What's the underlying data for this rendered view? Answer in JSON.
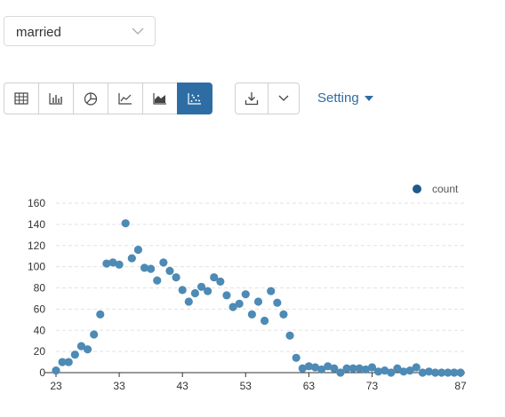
{
  "filter": {
    "selected": "married"
  },
  "toolbar": {
    "views": [
      {
        "icon": "table-icon"
      },
      {
        "icon": "bar-chart-icon"
      },
      {
        "icon": "pie-chart-icon"
      },
      {
        "icon": "line-chart-icon"
      },
      {
        "icon": "area-chart-icon"
      },
      {
        "icon": "scatter-chart-icon",
        "active": true
      }
    ],
    "setting_label": "Setting"
  },
  "colors": {
    "accent": "#2e6da4",
    "point": "#4d8ab5"
  },
  "chart_data": {
    "type": "scatter",
    "legend": "count",
    "legend_position": "top-right",
    "xlim": [
      23,
      87
    ],
    "ylim": [
      0,
      160
    ],
    "xticks": [
      23,
      33,
      43,
      53,
      63,
      73,
      87
    ],
    "yticks": [
      0,
      20,
      40,
      60,
      80,
      100,
      120,
      140,
      160
    ],
    "grid": true,
    "series": [
      {
        "name": "count",
        "x": [
          23,
          24,
          25,
          26,
          27,
          28,
          29,
          30,
          31,
          32,
          33,
          34,
          35,
          36,
          37,
          38,
          39,
          40,
          41,
          42,
          43,
          44,
          45,
          46,
          47,
          48,
          49,
          50,
          51,
          52,
          53,
          54,
          55,
          56,
          57,
          58,
          59,
          60,
          61,
          62,
          63,
          64,
          65,
          66,
          67,
          68,
          69,
          70,
          71,
          72,
          73,
          74,
          75,
          76,
          77,
          78,
          79,
          80,
          81,
          82,
          83,
          84,
          85,
          86,
          87
        ],
        "y": [
          2,
          10,
          10,
          17,
          25,
          22,
          36,
          55,
          103,
          104,
          102,
          141,
          108,
          116,
          99,
          98,
          87,
          104,
          96,
          90,
          78,
          67,
          75,
          81,
          77,
          90,
          86,
          73,
          62,
          65,
          74,
          55,
          67,
          49,
          77,
          66,
          55,
          35,
          14,
          4,
          6,
          5,
          3,
          6,
          4,
          0,
          4,
          4,
          4,
          3,
          5,
          1,
          2,
          0,
          4,
          1,
          2,
          5,
          0,
          1,
          0,
          0,
          0,
          0,
          0
        ]
      }
    ]
  }
}
